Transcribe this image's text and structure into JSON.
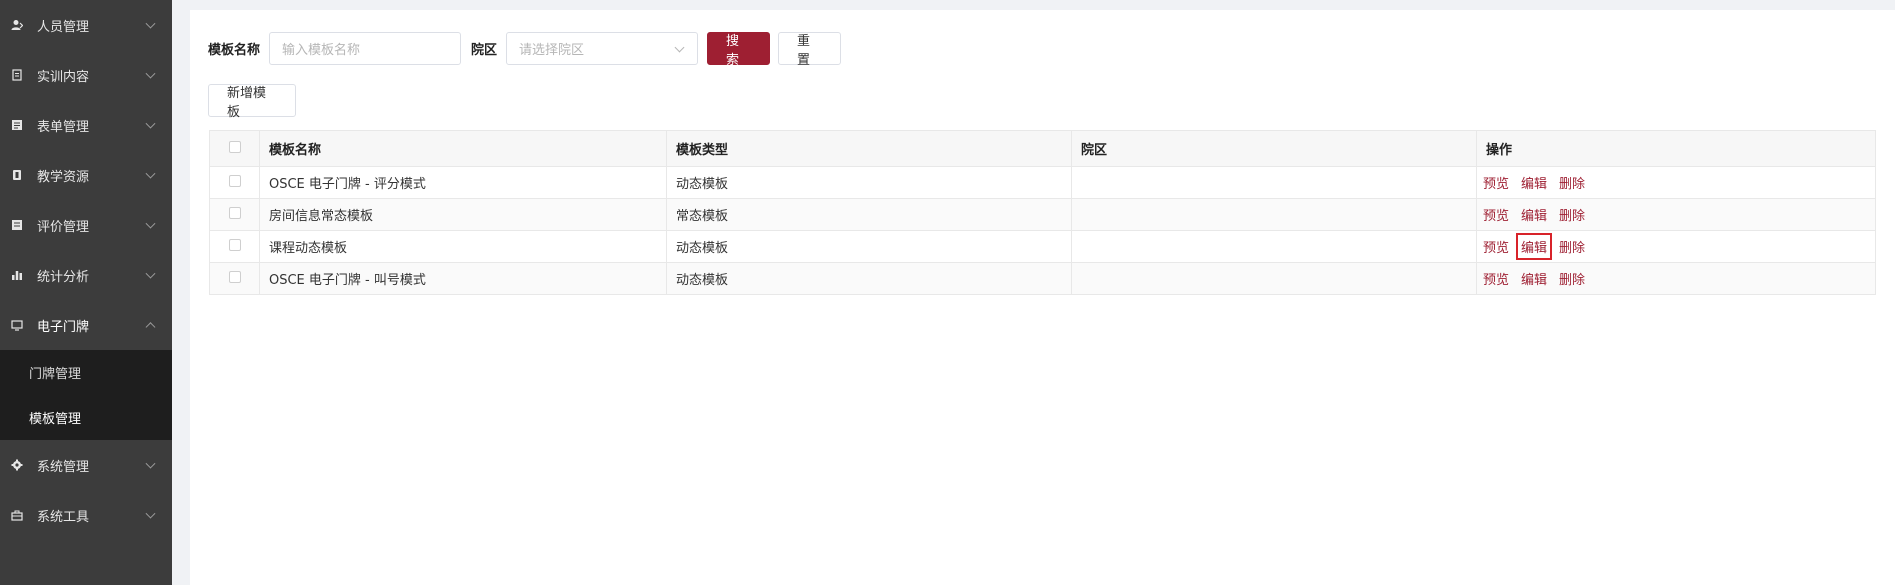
{
  "sidebar": {
    "items": [
      {
        "label": "人员管理",
        "icon": "user-icon"
      },
      {
        "label": "实训内容",
        "icon": "clipboard-icon"
      },
      {
        "label": "表单管理",
        "icon": "form-icon"
      },
      {
        "label": "教学资源",
        "icon": "book-icon"
      },
      {
        "label": "评价管理",
        "icon": "rating-icon"
      },
      {
        "label": "统计分析",
        "icon": "bar-chart-icon"
      },
      {
        "label": "电子门牌",
        "icon": "monitor-icon",
        "expanded": true
      }
    ],
    "submenu": [
      {
        "label": "门牌管理"
      },
      {
        "label": "模板管理",
        "active": true
      }
    ],
    "items_after": [
      {
        "label": "系统管理",
        "icon": "gear-icon"
      },
      {
        "label": "系统工具",
        "icon": "toolbox-icon"
      }
    ]
  },
  "filters": {
    "name_label": "模板名称",
    "name_placeholder": "输入模板名称",
    "campus_label": "院区",
    "campus_placeholder": "请选择院区",
    "search_label": "搜索",
    "reset_label": "重置"
  },
  "toolbar": {
    "add_label": "新增模板"
  },
  "table": {
    "headers": [
      "模板名称",
      "模板类型",
      "院区",
      "操作"
    ],
    "rows": [
      {
        "name": "OSCE 电子门牌 - 评分模式",
        "type": "动态模板",
        "campus": ""
      },
      {
        "name": "房间信息常态模板",
        "type": "常态模板",
        "campus": ""
      },
      {
        "name": "课程动态模板",
        "type": "动态模板",
        "campus": ""
      },
      {
        "name": "OSCE 电子门牌 - 叫号模式",
        "type": "动态模板",
        "campus": ""
      }
    ],
    "actions": {
      "preview": "预览",
      "edit": "编辑",
      "delete": "删除"
    }
  },
  "colors": {
    "primary": "#9e1f32",
    "sidebar_bg": "#3c3c3c",
    "submenu_bg": "#1e1e1e",
    "highlight": "#d8232a"
  }
}
